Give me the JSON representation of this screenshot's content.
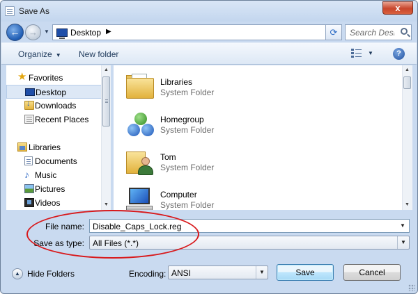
{
  "window": {
    "title": "Save As",
    "close_label": "x"
  },
  "nav": {
    "address": "Desktop",
    "search_placeholder": "Search Desktop"
  },
  "toolbar": {
    "organize_label": "Organize",
    "new_folder_label": "New folder",
    "help_label": "?"
  },
  "sidebar": {
    "favorites_label": "Favorites",
    "favorites": [
      {
        "label": "Desktop",
        "icon": "desktop-icon",
        "selected": true
      },
      {
        "label": "Downloads",
        "icon": "downloads-icon"
      },
      {
        "label": "Recent Places",
        "icon": "recent-places-icon"
      }
    ],
    "libraries_label": "Libraries",
    "libraries": [
      {
        "label": "Documents",
        "icon": "documents-icon"
      },
      {
        "label": "Music",
        "icon": "music-icon"
      },
      {
        "label": "Pictures",
        "icon": "pictures-icon"
      },
      {
        "label": "Videos",
        "icon": "videos-icon"
      }
    ]
  },
  "files": [
    {
      "name": "Libraries",
      "type": "System Folder",
      "icon": "libraries-folder-icon"
    },
    {
      "name": "Homegroup",
      "type": "System Folder",
      "icon": "homegroup-icon"
    },
    {
      "name": "Tom",
      "type": "System Folder",
      "icon": "user-folder-icon"
    },
    {
      "name": "Computer",
      "type": "System Folder",
      "icon": "computer-icon"
    }
  ],
  "form": {
    "file_name_label": "File name:",
    "file_name_value": "Disable_Caps_Lock.reg",
    "save_type_label": "Save as type:",
    "save_type_value": "All Files  (*.*)"
  },
  "footer": {
    "hide_folders_label": "Hide Folders",
    "encoding_label": "Encoding:",
    "encoding_value": "ANSI",
    "save_label": "Save",
    "cancel_label": "Cancel"
  },
  "colors": {
    "highlight_ellipse": "#d8191c",
    "selection": "#dde8f6"
  }
}
